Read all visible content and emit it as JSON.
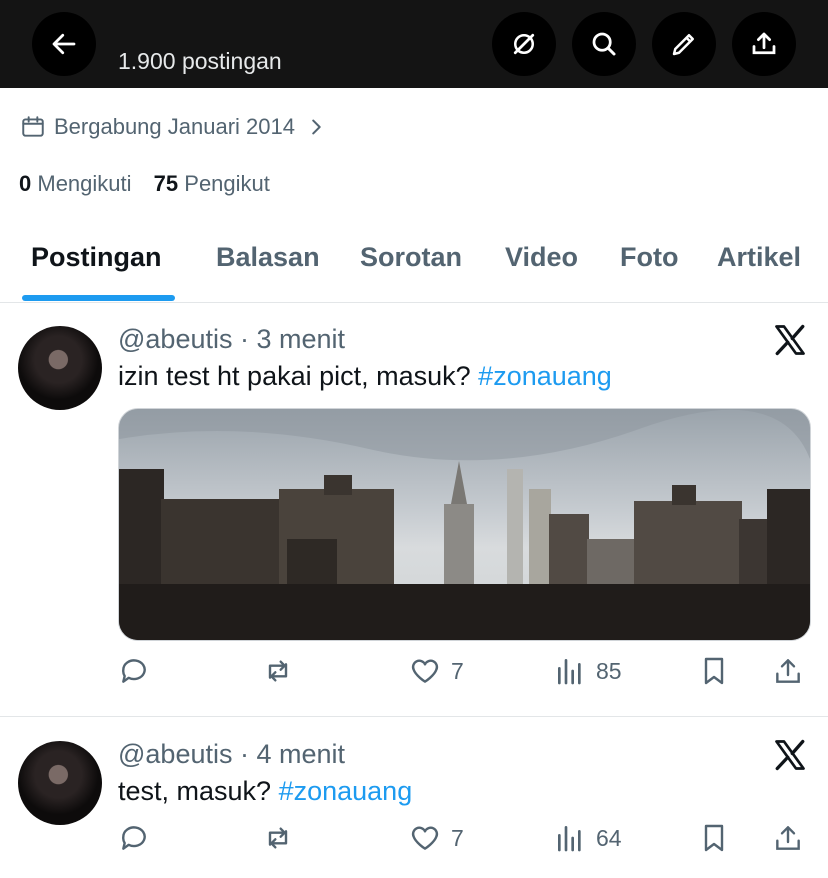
{
  "header": {
    "post_count": "1.900 postingan",
    "icons": [
      "back-arrow-icon",
      "grok-icon",
      "search-icon",
      "edit-icon",
      "share-icon"
    ]
  },
  "profile": {
    "joined": "Bergabung Januari 2014",
    "following_count": "0",
    "following_label": "Mengikuti",
    "followers_count": "75",
    "followers_label": "Pengikut"
  },
  "tabs": [
    {
      "label": "Postingan",
      "active": true
    },
    {
      "label": "Balasan"
    },
    {
      "label": "Sorotan"
    },
    {
      "label": "Video"
    },
    {
      "label": "Foto"
    },
    {
      "label": "Artikel"
    }
  ],
  "posts": [
    {
      "handle": "@abeutis",
      "time": "· 3 menit",
      "text": "izin test ht pakai pict, masuk? ",
      "hashtag": "#zonauang",
      "has_image": true,
      "likes": "7",
      "views": "85"
    },
    {
      "handle": "@abeutis",
      "time": "· 4 menit",
      "text": "test, masuk? ",
      "hashtag": "#zonauang",
      "has_image": false,
      "likes": "7",
      "views": "64"
    }
  ],
  "colors": {
    "accent": "#1d9bf0",
    "muted": "#536471",
    "text": "#0f1419",
    "topbar": "#141414"
  }
}
